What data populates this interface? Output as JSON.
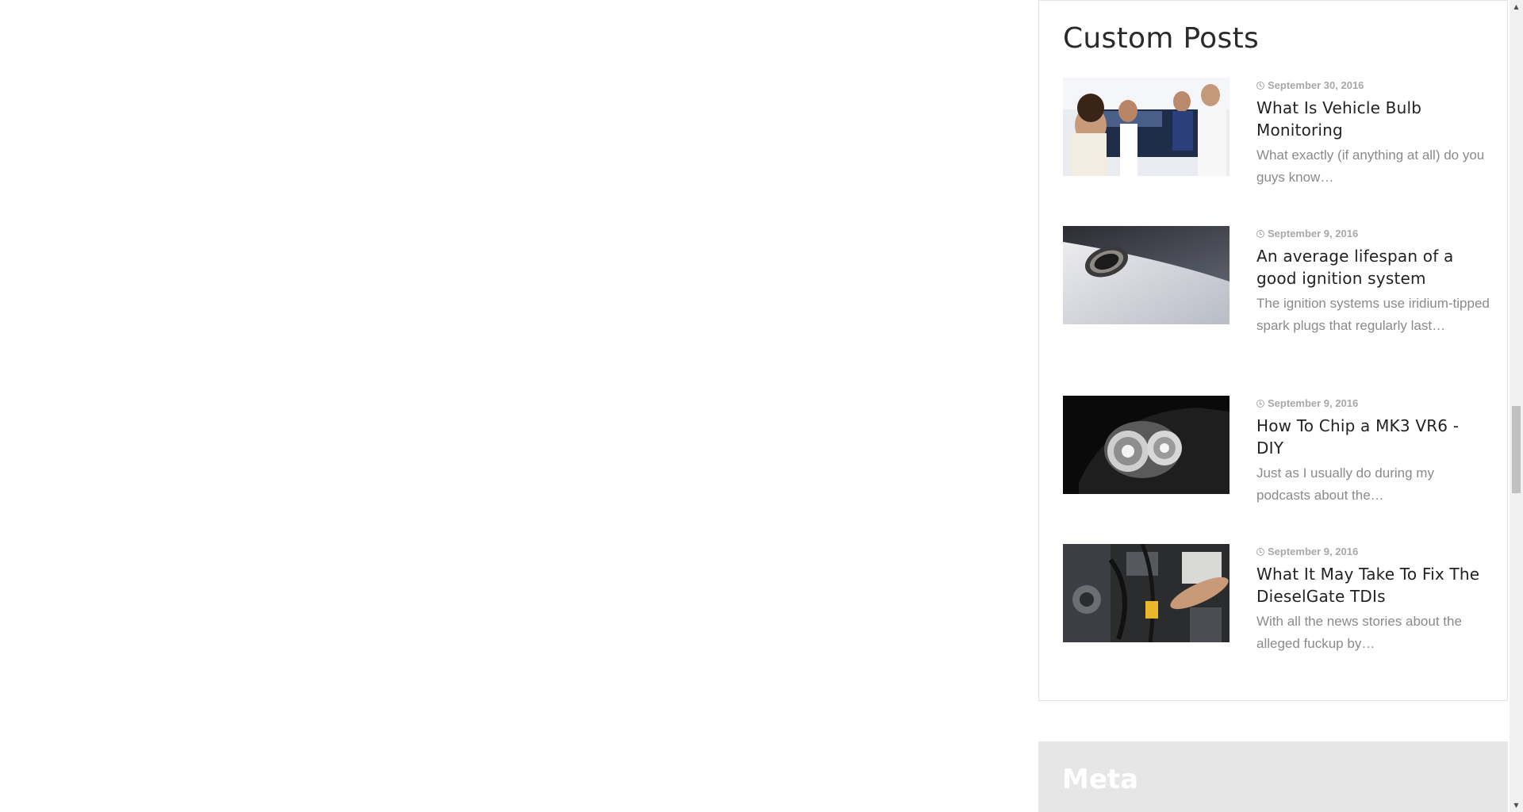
{
  "custom_posts_widget": {
    "title": "Custom Posts",
    "posts": [
      {
        "date": "September 30, 2016",
        "title": "What Is Vehicle Bulb Monitoring",
        "excerpt": "What exactly (if anything at all) do you guys know…",
        "image": "mechanics-with-customers"
      },
      {
        "date": "September 9, 2016",
        "title": "An average lifespan of a good ignition system",
        "excerpt": "The ignition systems use iridium-tipped spark plugs that regularly last…",
        "image": "exhaust-pipe"
      },
      {
        "date": "September 9, 2016",
        "title": "How To Chip a MK3 VR6 - DIY",
        "excerpt": "Just as I usually do during my podcasts about the…",
        "image": "car-headlight"
      },
      {
        "date": "September 9, 2016",
        "title": "What It May Take To Fix The DieselGate TDIs",
        "excerpt": "With all the news stories about the alleged fuckup by…",
        "image": "engine-bay"
      }
    ]
  },
  "meta_widget": {
    "title": "Meta"
  },
  "icons": {
    "date": "clock-icon",
    "scroll_up": "chevron-up-icon",
    "scroll_down": "chevron-down-icon"
  },
  "colors": {
    "title_text": "#222222",
    "date_text": "#a8a8a8",
    "excerpt_text": "#8a8a8a",
    "meta_background": "#e6e6e6"
  }
}
